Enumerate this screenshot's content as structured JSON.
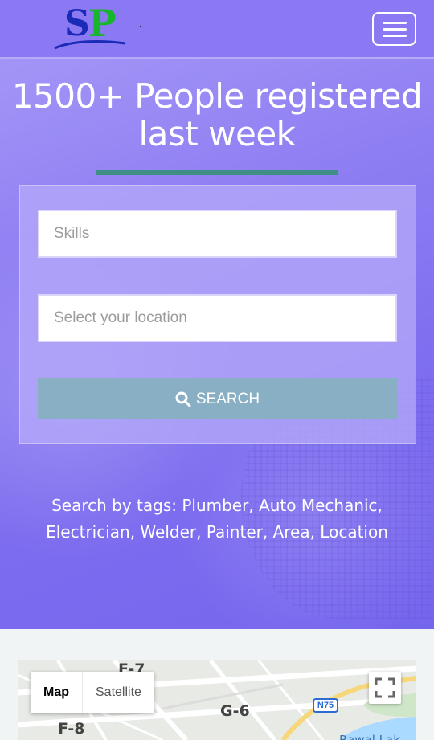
{
  "logo": {
    "letter_1": "S",
    "letter_2": "P"
  },
  "hero": {
    "headline_line1": "1500+ People registered",
    "headline_line2": "last week"
  },
  "search": {
    "skills_placeholder": "Skills",
    "location_placeholder": "Select your location",
    "button_label": "SEARCH"
  },
  "tags": {
    "line1": "Search by tags: Plumber, Auto Mechanic,",
    "line2": "Electrician, Welder, Painter, Area, Location"
  },
  "map": {
    "type_map": "Map",
    "type_satellite": "Satellite",
    "labels": {
      "f7": "F-7",
      "g6": "G-6",
      "f8": "F-8",
      "n75": "N75",
      "lake": "Rawal Lak"
    }
  },
  "colors": {
    "hero_bg": "#8f7ff3",
    "underline": "#3f8f86",
    "search_button": "#88afc4",
    "logo_s": "#1a2bb8",
    "logo_p": "#19b52f"
  },
  "icons": [
    "menu-icon",
    "search-icon",
    "fullscreen-icon"
  ]
}
